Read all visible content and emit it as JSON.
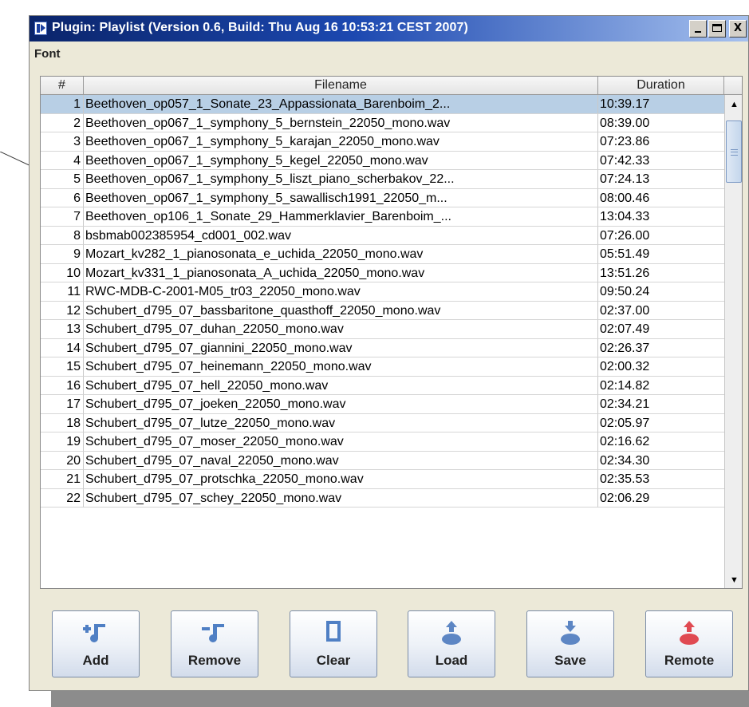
{
  "window": {
    "title": "Plugin: Playlist (Version 0.6, Build: Thu Aug 16 10:53:21 CEST 2007)",
    "controls": [
      "minimize",
      "maximize",
      "close"
    ],
    "close_glyph": "X"
  },
  "menu": {
    "items": [
      "Font"
    ]
  },
  "table": {
    "columns": [
      "#",
      "Filename",
      "Duration"
    ],
    "selected_row": 1,
    "rows": [
      {
        "num": "1",
        "filename": "Beethoven_op057_1_Sonate_23_Appassionata_Barenboim_2...",
        "duration": "10:39.17"
      },
      {
        "num": "2",
        "filename": "Beethoven_op067_1_symphony_5_bernstein_22050_mono.wav",
        "duration": "08:39.00"
      },
      {
        "num": "3",
        "filename": "Beethoven_op067_1_symphony_5_karajan_22050_mono.wav",
        "duration": "07:23.86"
      },
      {
        "num": "4",
        "filename": "Beethoven_op067_1_symphony_5_kegel_22050_mono.wav",
        "duration": "07:42.33"
      },
      {
        "num": "5",
        "filename": "Beethoven_op067_1_symphony_5_liszt_piano_scherbakov_22...",
        "duration": "07:24.13"
      },
      {
        "num": "6",
        "filename": "Beethoven_op067_1_symphony_5_sawallisch1991_22050_m...",
        "duration": "08:00.46"
      },
      {
        "num": "7",
        "filename": "Beethoven_op106_1_Sonate_29_Hammerklavier_Barenboim_...",
        "duration": "13:04.33"
      },
      {
        "num": "8",
        "filename": "bsbmab002385954_cd001_002.wav",
        "duration": "07:26.00"
      },
      {
        "num": "9",
        "filename": "Mozart_kv282_1_pianosonata_e_uchida_22050_mono.wav",
        "duration": "05:51.49"
      },
      {
        "num": "10",
        "filename": "Mozart_kv331_1_pianosonata_A_uchida_22050_mono.wav",
        "duration": "13:51.26"
      },
      {
        "num": "11",
        "filename": "RWC-MDB-C-2001-M05_tr03_22050_mono.wav",
        "duration": "09:50.24"
      },
      {
        "num": "12",
        "filename": "Schubert_d795_07_bassbaritone_quasthoff_22050_mono.wav",
        "duration": "02:37.00"
      },
      {
        "num": "13",
        "filename": "Schubert_d795_07_duhan_22050_mono.wav",
        "duration": "02:07.49"
      },
      {
        "num": "14",
        "filename": "Schubert_d795_07_giannini_22050_mono.wav",
        "duration": "02:26.37"
      },
      {
        "num": "15",
        "filename": "Schubert_d795_07_heinemann_22050_mono.wav",
        "duration": "02:00.32"
      },
      {
        "num": "16",
        "filename": "Schubert_d795_07_hell_22050_mono.wav",
        "duration": "02:14.82"
      },
      {
        "num": "17",
        "filename": "Schubert_d795_07_joeken_22050_mono.wav",
        "duration": "02:34.21"
      },
      {
        "num": "18",
        "filename": "Schubert_d795_07_lutze_22050_mono.wav",
        "duration": "02:05.97"
      },
      {
        "num": "19",
        "filename": "Schubert_d795_07_moser_22050_mono.wav",
        "duration": "02:16.62"
      },
      {
        "num": "20",
        "filename": "Schubert_d795_07_naval_22050_mono.wav",
        "duration": "02:34.30"
      },
      {
        "num": "21",
        "filename": "Schubert_d795_07_protschka_22050_mono.wav",
        "duration": "02:35.53"
      },
      {
        "num": "22",
        "filename": "Schubert_d795_07_schey_22050_mono.wav",
        "duration": "02:06.29"
      }
    ]
  },
  "toolbar": {
    "buttons": [
      {
        "label": "Add",
        "icon": "add-note-icon",
        "color": "#4f7fc4"
      },
      {
        "label": "Remove",
        "icon": "remove-note-icon",
        "color": "#4f7fc4"
      },
      {
        "label": "Clear",
        "icon": "clear-icon",
        "color": "#4f7fc4"
      },
      {
        "label": "Load",
        "icon": "load-icon",
        "color": "#5d86c4"
      },
      {
        "label": "Save",
        "icon": "save-icon",
        "color": "#5d86c4"
      },
      {
        "label": "Remote",
        "icon": "remote-icon",
        "color": "#e04a52"
      }
    ]
  },
  "colors": {
    "titlebar_start": "#0a246a",
    "selection": "#b8cfe5",
    "window_bg": "#ece9d8"
  }
}
